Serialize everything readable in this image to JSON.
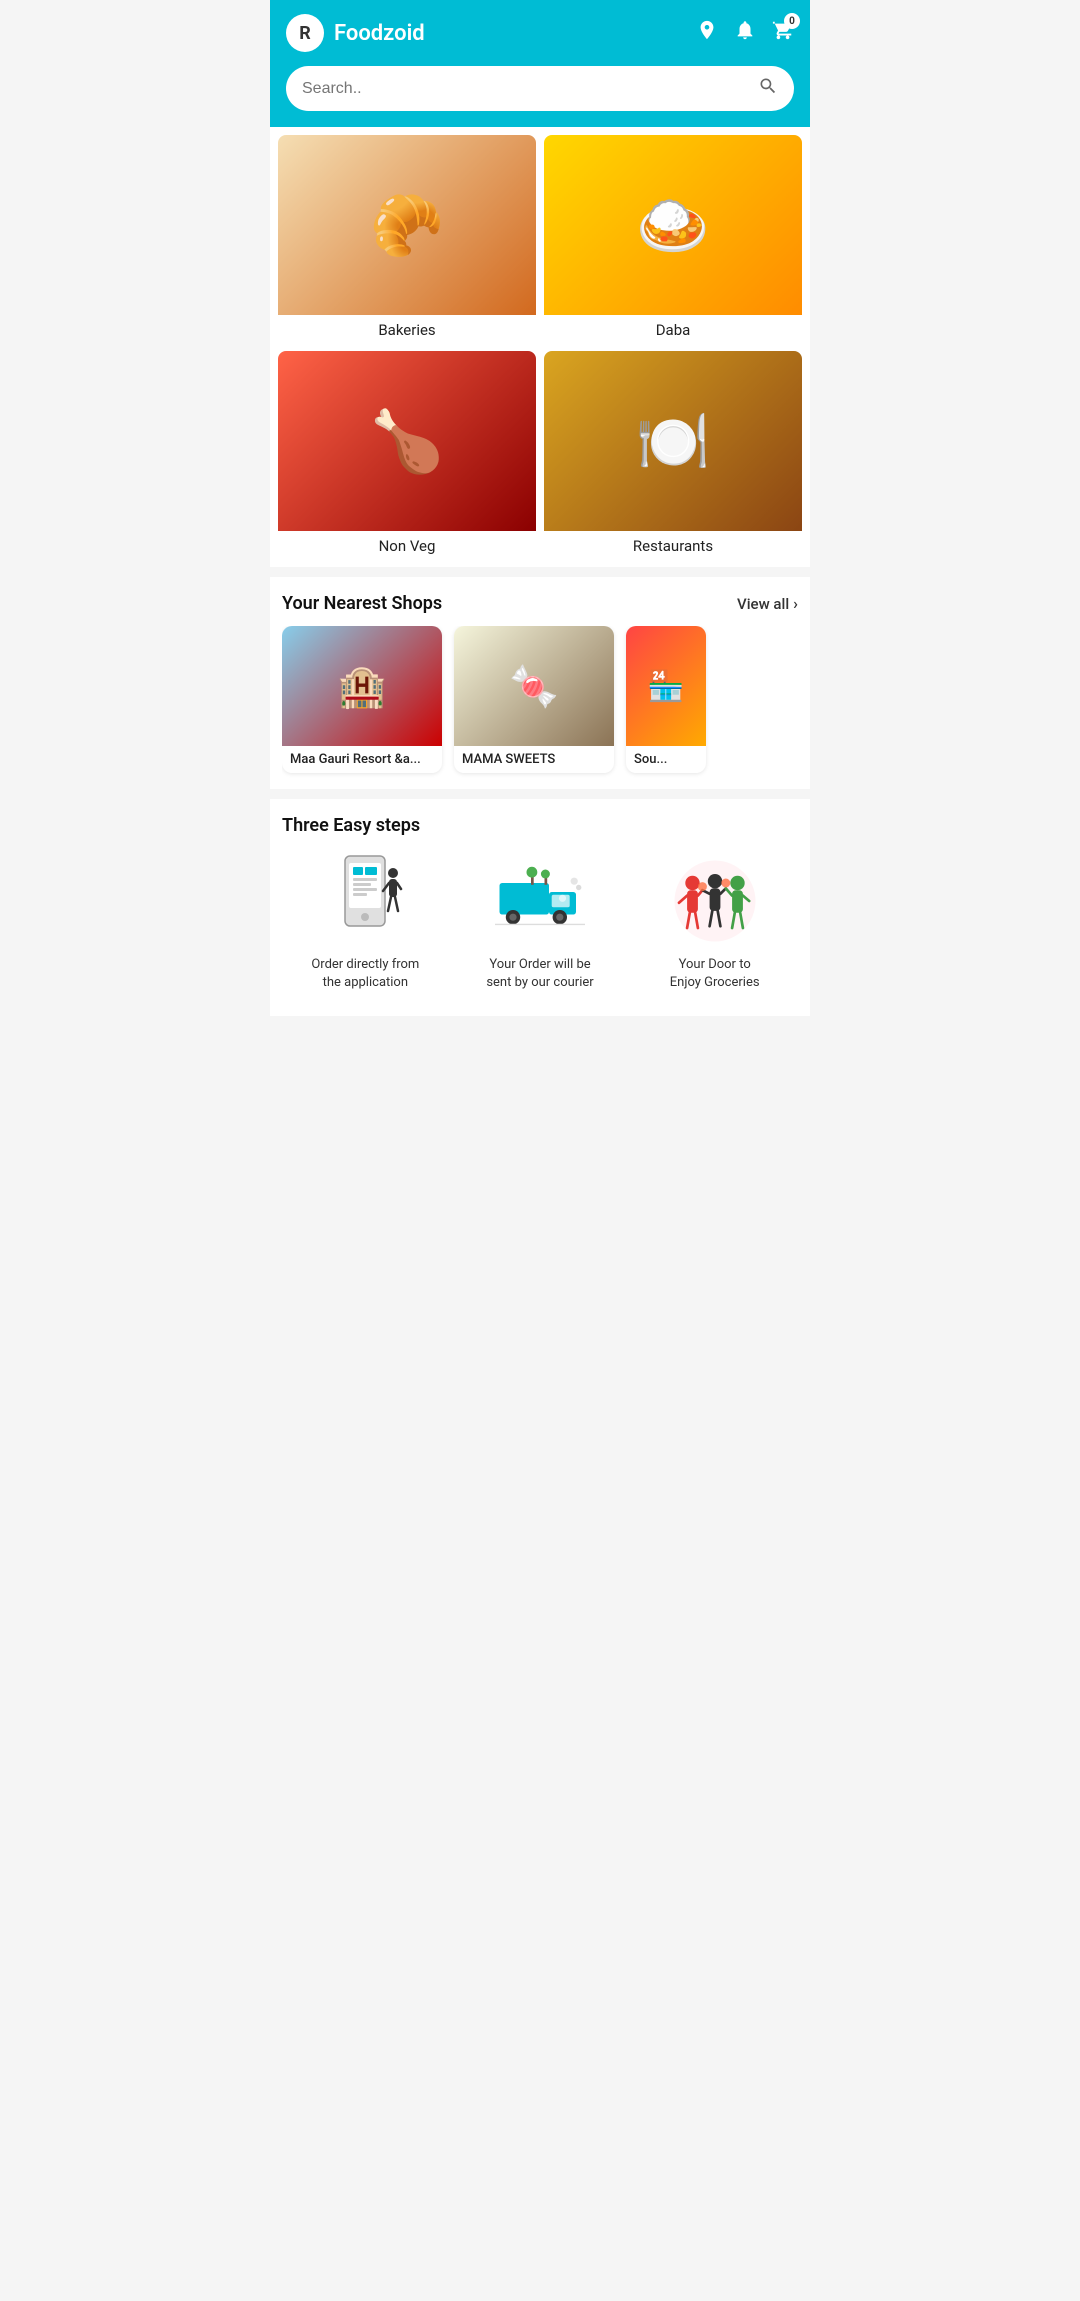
{
  "header": {
    "logo_letter": "R",
    "app_title": "Foodzoid",
    "cart_count": "0"
  },
  "search": {
    "placeholder": "Search.."
  },
  "categories": [
    {
      "id": "bakeries",
      "label": "Bakeries",
      "emoji": "🥐",
      "bg": "bg-bakeries"
    },
    {
      "id": "daba",
      "label": "Daba",
      "emoji": "🍛",
      "bg": "bg-daba"
    },
    {
      "id": "nonveg",
      "label": "Non Veg",
      "emoji": "🍗",
      "bg": "bg-nonveg"
    },
    {
      "id": "restaurants",
      "label": "Restaurants",
      "emoji": "🍽️",
      "bg": "bg-restaurants"
    }
  ],
  "nearest_shops": {
    "section_title": "Your Nearest Shops",
    "view_all_label": "View all",
    "shops": [
      {
        "id": "shop1",
        "name": "Maa Gauri Resort &a...",
        "bg": "bg-shop1",
        "emoji": "🏨"
      },
      {
        "id": "shop2",
        "name": "MAMA SWEETS",
        "bg": "bg-shop2",
        "emoji": "🍬"
      },
      {
        "id": "shop3",
        "name": "Sou...",
        "bg": "bg-shop3",
        "emoji": "🏪"
      }
    ]
  },
  "three_steps": {
    "section_title": "Three Easy steps",
    "steps": [
      {
        "id": "step1",
        "label": "Order directly from\nthe application",
        "icon_type": "phone"
      },
      {
        "id": "step2",
        "label": "Your Order will be\nsent by our courier",
        "icon_type": "truck"
      },
      {
        "id": "step3",
        "label": "Your Door to\nEnjoy Groceries",
        "icon_type": "people"
      }
    ]
  }
}
